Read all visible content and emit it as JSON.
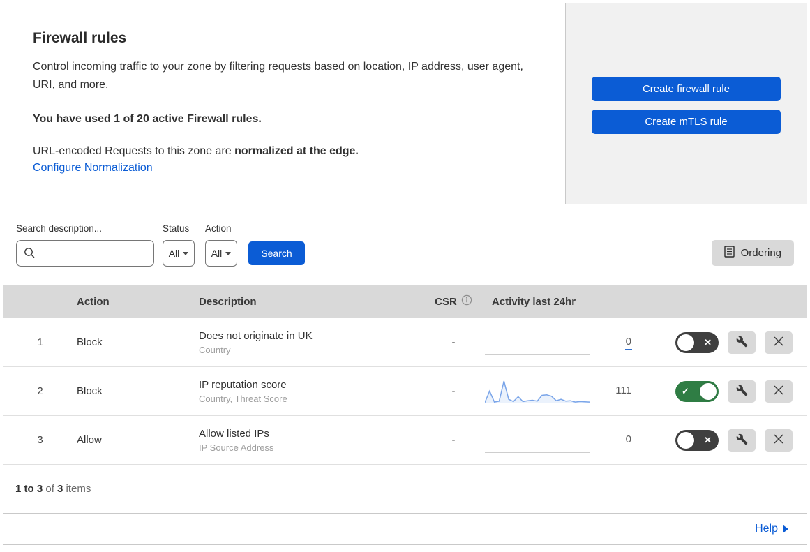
{
  "intro": {
    "title": "Firewall rules",
    "description": "Control incoming traffic to your zone by filtering requests based on location, IP address, user agent, URI, and more.",
    "usage": "You have used 1 of 20 active Firewall rules.",
    "normalization_text": "URL-encoded Requests to this zone are ",
    "normalization_bold": "normalized at the edge.",
    "normalization_link": "Configure Normalization"
  },
  "cta": {
    "create_firewall_label": "Create firewall rule",
    "create_mtls_label": "Create mTLS rule"
  },
  "filters": {
    "search_label": "Search description...",
    "status_label": "Status",
    "status_value": "All",
    "action_label": "Action",
    "action_value": "All",
    "search_button": "Search",
    "ordering_button": "Ordering"
  },
  "table": {
    "headers": {
      "action": "Action",
      "description": "Description",
      "csr": "CSR",
      "activity": "Activity last 24hr"
    },
    "rows": [
      {
        "index": "1",
        "action": "Block",
        "description": "Does not originate in UK",
        "fields": "Country",
        "csr": "-",
        "activity_count": "0",
        "enabled": false
      },
      {
        "index": "2",
        "action": "Block",
        "description": "IP reputation score",
        "fields": "Country, Threat Score",
        "csr": "-",
        "activity_count": "111",
        "enabled": true
      },
      {
        "index": "3",
        "action": "Allow",
        "description": "Allow listed IPs",
        "fields": "IP Source Address",
        "csr": "-",
        "activity_count": "0",
        "enabled": false
      }
    ]
  },
  "footer": {
    "count_range": "1 to 3",
    "count_mid": " of ",
    "count_total": "3",
    "count_suffix": " items",
    "help_label": "Help"
  },
  "icons": {
    "search": "magnifier-icon",
    "ordering": "list-document-icon",
    "info": "info-circle-icon",
    "toggle_on": "check-icon",
    "toggle_off": "x-icon",
    "edit": "wrench-icon",
    "delete": "x-icon",
    "help": "chevron-right-icon",
    "dropdown": "caret-down-icon"
  },
  "colors": {
    "accent_blue": "#0b5cd5",
    "link_blue": "#0b5cd5",
    "toggle_on_green": "#2f7d44",
    "toggle_off_gray": "#3f3f3f",
    "table_header_bg": "#d9d9d9",
    "panel_gray": "#f1f1f1",
    "sparkline_blue": "#7aa5e9"
  },
  "chart_data": [
    {
      "type": "line",
      "title": "Activity last 24hr - rule 1",
      "values": [
        0,
        0
      ],
      "total": 0,
      "ylim": [
        0,
        100
      ],
      "color": "#bdbdbd"
    },
    {
      "type": "line",
      "title": "Activity last 24hr - rule 2",
      "values": [
        4,
        55,
        6,
        10,
        100,
        18,
        8,
        30,
        8,
        12,
        14,
        10,
        36,
        38,
        32,
        12,
        18,
        10,
        12,
        6,
        8,
        7,
        6
      ],
      "total": 111,
      "ylim": [
        0,
        100
      ],
      "color": "#7aa5e9"
    },
    {
      "type": "line",
      "title": "Activity last 24hr - rule 3",
      "values": [
        0,
        0
      ],
      "total": 0,
      "ylim": [
        0,
        100
      ],
      "color": "#bdbdbd"
    }
  ]
}
